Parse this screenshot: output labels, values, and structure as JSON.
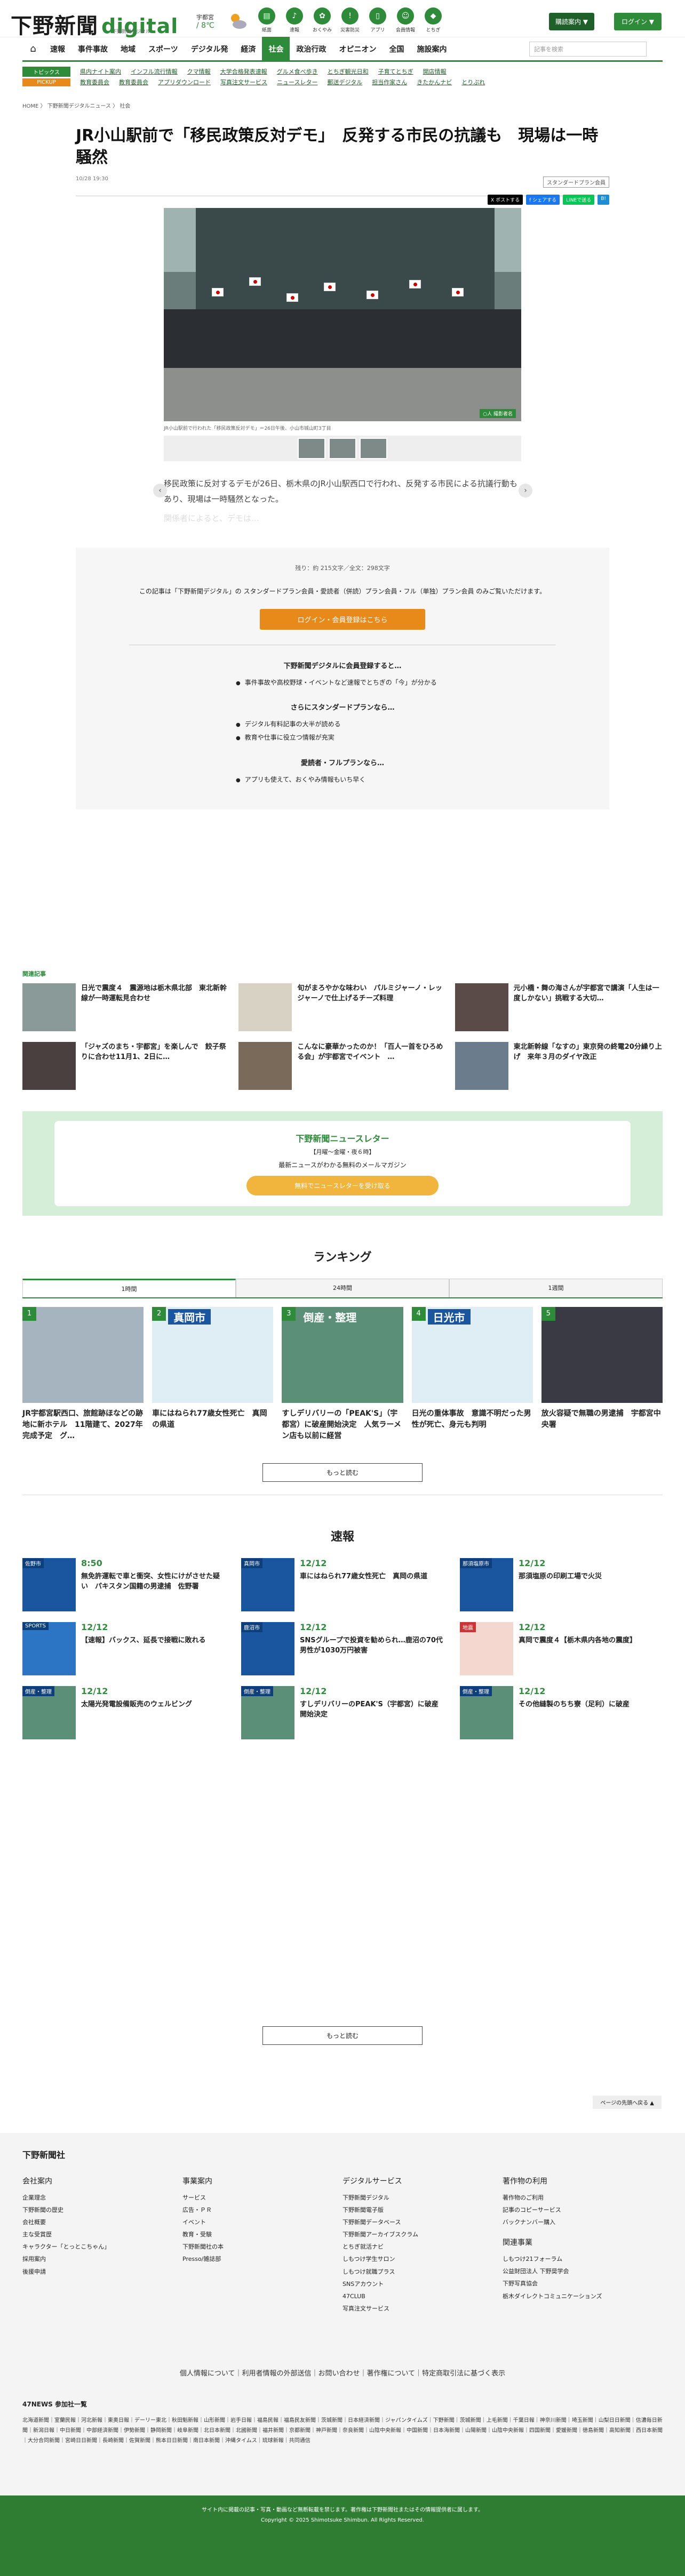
{
  "header": {
    "logo": "下野新聞",
    "logo_digital": "digital",
    "logo_sub": "下野新聞デジタル",
    "weather_city": "宇都宮",
    "weather_temp": "8℃",
    "weather_sep": "/ ",
    "icons": [
      {
        "label": "紙面",
        "icon": "paper-icon"
      },
      {
        "label": "速報",
        "icon": "bell-icon"
      },
      {
        "label": "おくやみ",
        "icon": "flower-icon"
      },
      {
        "label": "災害防災",
        "icon": "alert-icon"
      },
      {
        "label": "アプリ",
        "icon": "app-icon"
      },
      {
        "label": "会員情報",
        "icon": "user-icon"
      },
      {
        "label": "とちぎ",
        "icon": "map-icon"
      }
    ],
    "subscribe": "購読案内 ▼",
    "login": "ログイン ▼"
  },
  "gnav": {
    "items": [
      "速報",
      "事件事故",
      "地域",
      "スポーツ",
      "デジタル発",
      "経済",
      "社会",
      "政治行政",
      "オピニオン",
      "全国",
      "施設案内"
    ],
    "active": "社会",
    "search_placeholder": "記事を検索"
  },
  "subnav": {
    "topics_label": "トピックス",
    "topics": [
      "県内ナイト案内",
      "インフル流行情報",
      "クマ情報",
      "大学合格発表速報",
      "グルメ食べ歩き",
      "とちぎ観光日和",
      "子育てとちぎ",
      "開店情報"
    ],
    "pickup_label": "PICKUP",
    "pickup": [
      "教育委員会",
      "教育委員会",
      "アプリダウンロード",
      "写真注文サービス",
      "ニュースレター",
      "郵送デジタル",
      "担当作家さん",
      "きたかんナビ",
      "とりぷれ"
    ]
  },
  "breadcrumb": "HOME  〉  下野新聞デジタルニュース  〉  社会",
  "article": {
    "title": "JR小山駅前で「移民政策反対デモ」　反発する市民の抗議も　現場は一時騒然",
    "date": "10/28 19:30",
    "plan_badge": "スタンダードプラン会員",
    "share": [
      "X ポストする",
      "f シェアする",
      "LINEで送る",
      "B!"
    ],
    "caption": "JR小山駅前で行われた「移民政策反対デモ」＝26日午後、小山市城山町3丁目",
    "photo_credit": "○人 撮影者名",
    "lead": "移民政策に反対するデモが26日、栃木県のJR小山駅西口で行われ、反発する市民による抗議行動もあり、現場は一時騒然となった。",
    "fade": "関係者によると、デモは…"
  },
  "paywall": {
    "count": "残り：約 215文字／全文：298文字",
    "msg": "この記事は「下野新聞デジタル」の スタンダードプラン会員・愛読者（併読）プラン会員・フル（単独）プラン会員 のみご覧いただけます。",
    "button": "ログイン・会員登録はこちら",
    "h1": "下野新聞デジタルに会員登録すると…",
    "l1": [
      "事件事故や高校野球・イベントなど速報でとちぎの「今」が分かる"
    ],
    "h2": "さらにスタンダードプランなら…",
    "l2": [
      "デジタル有料記事の大半が読める",
      "教育や仕事に役立つ情報が充実"
    ],
    "h3": "愛読者・フルプランなら…",
    "l3": [
      "アプリも使えて、おくやみ情報もいち早く"
    ]
  },
  "related": {
    "heading": "関連記事",
    "items": [
      "日光で震度４　震源地は栃木県北部　東北新幹線が一時運転見合わせ",
      "旬がまろやかな味わい　パルミジャーノ・レッジャーノで仕上げるチーズ料理",
      "元小橋・舞の海さんが宇都宮で講演「人生は一度しかない」挑戦する大切…",
      "「ジャズのまち・宇都宮」を楽しんで　餃子祭りに合わせ11月1、2日に…",
      "こんなに豪華かったのか！「百人一首をひろめる会」が宇都宮でイベント　…",
      "東北新幹線「なすの」東京発の終電20分繰り上げ　来年３月のダイヤ改正"
    ]
  },
  "newsletter": {
    "title": "下野新聞ニュースレター",
    "sub": "【月曜～金曜・夜６時】",
    "desc": "最新ニュースがわかる無料のメールマガジン",
    "button": "無料でニュースレターを受け取る"
  },
  "ranking": {
    "heading": "ランキング",
    "tabs": [
      "1時間",
      "24時間",
      "1週間"
    ],
    "items": [
      {
        "n": "1",
        "lbl": "",
        "t": "JR宇都宮駅西口、旅館跡ほなどの跡地に新ホテル　11階建て、2027年完成予定　グ…"
      },
      {
        "n": "2",
        "lbl": "真岡市",
        "t": "車にはねられ77歳女性死亡　真岡の県道"
      },
      {
        "n": "3",
        "lbl": "倒産・整理",
        "t": "すしデリバリーの「PEAK'S」（宇都宮）に破産開始決定　人気ラーメン店も以前に経営"
      },
      {
        "n": "4",
        "lbl": "日光市",
        "t": "日光の重体事故　意識不明だった男性が死亡、身元も判明"
      },
      {
        "n": "5",
        "lbl": "",
        "t": "放火容疑で無職の男逮捕　宇都宮中央署"
      }
    ],
    "more": "もっと読む"
  },
  "sokuho": {
    "heading": "速報",
    "items": [
      {
        "pl": "佐野市",
        "d": "8:50",
        "t": "無免許運転で車と衝突、女性にけがさせた疑い　パキスタン国籍の男逮捕　佐野署"
      },
      {
        "pl": "真岡市",
        "d": "12/12",
        "t": "車にはねられ77歳女性死亡　真岡の県道"
      },
      {
        "pl": "那須塩原市",
        "d": "12/12",
        "t": "那須塩原の印刷工場で火災"
      },
      {
        "pl": "SPORTS",
        "d": "12/12",
        "t": "【速報】バックス、延長で接戦に敗れる"
      },
      {
        "pl": "鹿沼市",
        "d": "12/12",
        "t": "SNSグループで投資を勧められ…鹿沼の70代男性が1030万円被害"
      },
      {
        "pl": "地震",
        "d": "12/12",
        "t": "真岡で震度４【栃木県内各地の震度】"
      },
      {
        "pl": "倒産・整理",
        "d": "12/12",
        "t": "太陽光発電設備販売のウェルビング"
      },
      {
        "pl": "倒産・整理",
        "d": "12/12",
        "t": "すしデリバリーのPEAK'S（宇都宮）に破産開始決定"
      },
      {
        "pl": "倒産・整理",
        "d": "12/12",
        "t": "その他縫製のちち寮（足利）に破産"
      }
    ],
    "more": "もっと読む"
  },
  "pagetop": "ページの先頭へ戻る ▲",
  "footer": {
    "logo": "下野新聞社",
    "cols": [
      {
        "h": "会社案内",
        "i": [
          "企業理念",
          "下野新聞の歴史",
          "会社概要",
          "主な受賞歴",
          "キャラクター「とっとこちゃん」",
          "採用案内",
          "後援申請"
        ]
      },
      {
        "h": "事業案内",
        "i": [
          "サービス",
          "広告・ＰＲ",
          "イベント",
          "教育・受験",
          "下野新聞社の本",
          "Presso/雑誌部"
        ]
      },
      {
        "h": "デジタルサービス",
        "i": [
          "下野新聞デジタル",
          "下野新聞電子版",
          "下野新聞データベース",
          "下野新聞アーカイブスクラム",
          "とちぎ就活ナビ",
          "しもつけ学生サロン",
          "しもつけ就職プラス",
          "SNSアカウント",
          "47CLUB",
          "写真注文サービス"
        ]
      },
      {
        "h": "著作物の利用",
        "i": [
          "著作物のご利用",
          "記事のコピーサービス",
          "バックナンバー購入"
        ],
        "h2": "関連事業",
        "i2": [
          "しもつけ21フォーラム",
          "公益財団法人 下野奨学会",
          "下野写真協会",
          "栃木ダイレクトコミュニケーションズ"
        ]
      }
    ],
    "links": "個人情報について｜利用者情報の外部送信｜お問い合わせ｜著作権について｜特定商取引法に基づく表示",
    "n47": "47NEWS 参加社一覧",
    "n47list": "北海道新聞｜室蘭民報｜河北新報｜東奥日報｜デーリー東北｜秋田魁新報｜山形新聞｜岩手日報｜福島民報｜福島民友新聞｜茨城新聞｜日本経済新聞｜ジャパンタイムズ｜下野新聞｜茨城新聞｜上毛新聞｜千葉日報｜神奈川新聞｜埼玉新聞｜山梨日日新聞｜信濃毎日新聞｜新潟日報｜中日新聞｜中部経済新聞｜伊勢新聞｜静岡新聞｜岐阜新聞｜北日本新聞｜北國新聞｜福井新聞｜京都新聞｜神戸新聞｜奈良新聞｜山陰中央新報｜中国新聞｜日本海新聞｜山陽新聞｜山陰中央新報｜四国新聞｜愛媛新聞｜徳島新聞｜高知新聞｜西日本新聞｜大分合同新聞｜宮崎日日新聞｜長崎新聞｜佐賀新聞｜熊本日日新聞｜南日本新聞｜沖縄タイムス｜琉球新報｜共同通信",
    "notice": "サイト内に掲載の記事・写真・動画など無断転載を禁じます。著作権は下野新聞社またはその情報提供者に属します。",
    "copyright": "Copyright © 2025 Shimotsuke Shimbun. All Rights Reserved."
  }
}
